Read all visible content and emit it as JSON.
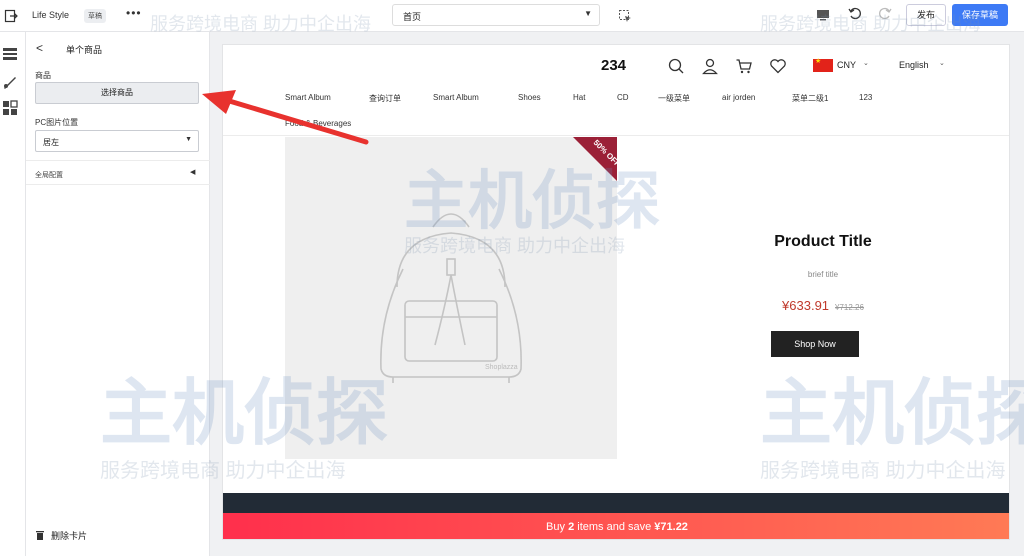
{
  "topbar": {
    "title": "Life Style",
    "badge": "草稿",
    "more": "•••",
    "page_select": "首页",
    "publish_label": "发布",
    "save_label": "保存草稿"
  },
  "panel": {
    "back": "<",
    "title": "单个商品",
    "product_label": "商品",
    "choose_product": "选择商品",
    "pc_image_label": "PC图片位置",
    "pc_image_value": "居左",
    "global_config": "全局配置",
    "delete_card": "删除卡片"
  },
  "store": {
    "logo": "234",
    "currency": "CNY",
    "language": "English",
    "nav": [
      "Smart Album",
      "查询订单",
      "Smart Album",
      "Shoes",
      "Hat",
      "CD",
      "一级菜单",
      "air jorden",
      "菜单二级1",
      "123",
      "Food & Beverages"
    ],
    "ribbon_text": "50% OFF",
    "image_brand": "Shoplazza",
    "product_title": "Product Title",
    "brief_title": "brief title",
    "price_now": "¥633.91",
    "price_was": "¥712.26",
    "shop_now": "Shop Now",
    "promo_pre": "Buy ",
    "promo_count": "2",
    "promo_mid": " items and save ",
    "promo_amount": "¥71.22"
  },
  "watermark": {
    "logo_text": "主机侦探",
    "tagline": "服务跨境电商 助力中企出海"
  },
  "colors": {
    "accent": "#3d7af5",
    "price": "#c0392b",
    "promo_start": "#ff2f4c",
    "promo_end": "#ff7a55",
    "arrow": "#e8322e"
  }
}
